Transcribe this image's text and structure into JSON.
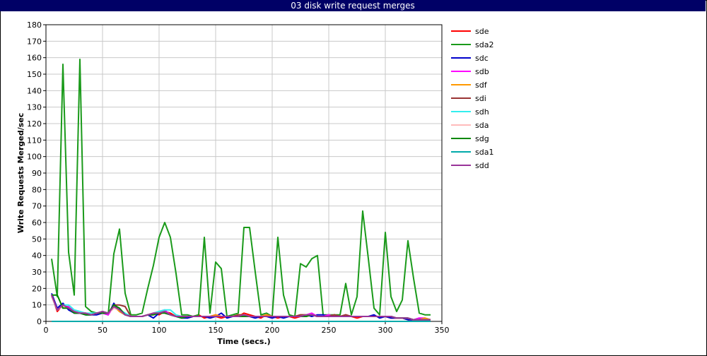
{
  "chart_data": {
    "type": "line",
    "title": "03 disk write request merges",
    "xlabel": "Time (secs.)",
    "ylabel": "Write Requests Merged/sec",
    "xlim": [
      0,
      350
    ],
    "ylim": [
      0,
      180
    ],
    "xticks": [
      0,
      50,
      100,
      150,
      200,
      250,
      300,
      350
    ],
    "yticks": [
      0,
      10,
      20,
      30,
      40,
      50,
      60,
      70,
      80,
      90,
      100,
      110,
      120,
      130,
      140,
      150,
      160,
      170,
      180
    ],
    "grid": true,
    "legend_position": "right",
    "x": [
      5,
      10,
      15,
      20,
      25,
      30,
      35,
      40,
      45,
      50,
      55,
      60,
      65,
      70,
      75,
      80,
      85,
      90,
      95,
      100,
      105,
      110,
      115,
      120,
      125,
      130,
      135,
      140,
      145,
      150,
      155,
      160,
      165,
      170,
      175,
      180,
      185,
      190,
      195,
      200,
      205,
      210,
      215,
      220,
      225,
      230,
      235,
      240,
      245,
      250,
      255,
      260,
      265,
      270,
      275,
      280,
      285,
      290,
      295,
      300,
      305,
      310,
      315,
      320,
      325,
      330,
      335,
      340
    ],
    "series": [
      {
        "name": "sde",
        "color": "#ff0000",
        "values": [
          16,
          6,
          10,
          8,
          5,
          5,
          5,
          4,
          5,
          6,
          5,
          8,
          7,
          4,
          3,
          3,
          3,
          4,
          5,
          4,
          6,
          5,
          3,
          3,
          2,
          3,
          4,
          2,
          3,
          3,
          2,
          3,
          3,
          3,
          5,
          4,
          3,
          2,
          4,
          3,
          2,
          3,
          3,
          2,
          3,
          3,
          4,
          3,
          3,
          3,
          4,
          3,
          3,
          3,
          2,
          3,
          3,
          3,
          3,
          3,
          2,
          2,
          2,
          1,
          1,
          1,
          2,
          1
        ]
      },
      {
        "name": "sda2",
        "color": "#1a9a1a",
        "values": [
          38,
          15,
          156,
          42,
          16,
          159,
          9,
          6,
          5,
          5,
          4,
          41,
          56,
          17,
          4,
          4,
          5,
          20,
          34,
          51,
          60,
          51,
          29,
          4,
          4,
          3,
          4,
          51,
          5,
          36,
          32,
          3,
          4,
          5,
          57,
          57,
          30,
          4,
          5,
          3,
          51,
          16,
          4,
          3,
          35,
          33,
          38,
          40,
          4,
          4,
          4,
          4,
          23,
          4,
          15,
          67,
          38,
          8,
          4,
          54,
          15,
          6,
          13,
          49,
          26,
          5,
          4,
          4
        ]
      },
      {
        "name": "sdc",
        "color": "#0000cc",
        "values": [
          17,
          8,
          11,
          7,
          5,
          5,
          4,
          4,
          4,
          5,
          4,
          11,
          6,
          4,
          3,
          3,
          3,
          4,
          2,
          5,
          6,
          4,
          3,
          2,
          2,
          3,
          3,
          3,
          2,
          3,
          5,
          2,
          3,
          3,
          3,
          3,
          2,
          3,
          3,
          2,
          3,
          2,
          3,
          3,
          3,
          4,
          3,
          4,
          4,
          3,
          4,
          3,
          4,
          3,
          3,
          3,
          3,
          4,
          2,
          3,
          2,
          2,
          2,
          1,
          1,
          2,
          1,
          1
        ]
      },
      {
        "name": "sdb",
        "color": "#ff00ff",
        "values": [
          16,
          7,
          9,
          9,
          6,
          5,
          5,
          4,
          5,
          5,
          4,
          9,
          7,
          4,
          3,
          3,
          3,
          4,
          4,
          6,
          7,
          4,
          3,
          3,
          3,
          3,
          3,
          3,
          3,
          4,
          3,
          3,
          3,
          3,
          4,
          3,
          3,
          3,
          4,
          3,
          3,
          3,
          3,
          3,
          4,
          4,
          5,
          3,
          3,
          4,
          3,
          3,
          4,
          3,
          3,
          3,
          3,
          3,
          3,
          3,
          3,
          2,
          2,
          2,
          1,
          2,
          2,
          1
        ]
      },
      {
        "name": "sdf",
        "color": "#ff9900",
        "values": [
          15,
          7,
          10,
          8,
          6,
          5,
          5,
          4,
          5,
          6,
          5,
          9,
          6,
          4,
          3,
          3,
          3,
          4,
          5,
          5,
          6,
          4,
          3,
          3,
          3,
          3,
          3,
          3,
          3,
          4,
          3,
          3,
          3,
          4,
          4,
          3,
          3,
          3,
          4,
          3,
          3,
          3,
          3,
          3,
          4,
          4,
          4,
          3,
          3,
          3,
          4,
          3,
          4,
          3,
          3,
          3,
          3,
          3,
          3,
          3,
          3,
          2,
          2,
          2,
          1,
          1,
          2,
          1
        ]
      },
      {
        "name": "sdi",
        "color": "#993333",
        "values": [
          16,
          7,
          10,
          8,
          6,
          5,
          5,
          4,
          5,
          6,
          5,
          10,
          10,
          9,
          3,
          3,
          3,
          4,
          5,
          6,
          6,
          4,
          3,
          3,
          3,
          3,
          3,
          3,
          3,
          3,
          3,
          3,
          3,
          4,
          4,
          3,
          3,
          3,
          3,
          3,
          3,
          3,
          3,
          3,
          4,
          4,
          4,
          3,
          3,
          3,
          4,
          3,
          4,
          3,
          3,
          3,
          3,
          3,
          3,
          3,
          3,
          2,
          2,
          2,
          1,
          1,
          1,
          1
        ]
      },
      {
        "name": "sdh",
        "color": "#33eeee",
        "values": [
          15,
          7,
          10,
          10,
          7,
          6,
          5,
          5,
          5,
          6,
          5,
          9,
          7,
          5,
          3,
          3,
          3,
          4,
          5,
          6,
          7,
          7,
          4,
          3,
          3,
          3,
          3,
          3,
          3,
          3,
          3,
          3,
          3,
          3,
          4,
          3,
          3,
          3,
          3,
          3,
          3,
          3,
          3,
          3,
          3,
          4,
          4,
          3,
          3,
          3,
          3,
          3,
          3,
          3,
          3,
          3,
          3,
          3,
          3,
          3,
          3,
          2,
          2,
          2,
          1,
          1,
          1,
          1
        ]
      },
      {
        "name": "sda",
        "color": "#ffbbbb",
        "values": [
          15,
          7,
          9,
          8,
          6,
          5,
          5,
          4,
          5,
          6,
          5,
          8,
          7,
          4,
          3,
          3,
          3,
          4,
          5,
          5,
          6,
          4,
          3,
          3,
          3,
          3,
          3,
          3,
          3,
          3,
          3,
          3,
          3,
          3,
          4,
          3,
          3,
          3,
          3,
          3,
          3,
          3,
          3,
          3,
          3,
          4,
          4,
          3,
          3,
          3,
          3,
          3,
          3,
          3,
          3,
          3,
          3,
          3,
          3,
          3,
          3,
          2,
          2,
          2,
          1,
          1,
          1,
          1
        ]
      },
      {
        "name": "sdg",
        "color": "#008800",
        "values": [
          16,
          16,
          8,
          8,
          5,
          5,
          4,
          4,
          5,
          5,
          5,
          10,
          8,
          4,
          3,
          3,
          3,
          4,
          4,
          5,
          5,
          4,
          3,
          2,
          3,
          3,
          3,
          3,
          3,
          3,
          3,
          3,
          3,
          3,
          3,
          3,
          3,
          3,
          3,
          3,
          3,
          3,
          3,
          3,
          3,
          3,
          4,
          3,
          3,
          3,
          3,
          3,
          3,
          3,
          3,
          3,
          3,
          3,
          3,
          3,
          3,
          2,
          2,
          2,
          1,
          1,
          1,
          1
        ]
      },
      {
        "name": "sda1",
        "color": "#00aaaa",
        "values": [
          0,
          0,
          0,
          0,
          0,
          0,
          0,
          0,
          0,
          0,
          0,
          0,
          0,
          0,
          0,
          0,
          0,
          0,
          0,
          0,
          0,
          0,
          0,
          0,
          0,
          0,
          0,
          0,
          0,
          0,
          0,
          0,
          0,
          0,
          0,
          0,
          0,
          0,
          0,
          0,
          0,
          0,
          0,
          0,
          0,
          0,
          0,
          0,
          0,
          0,
          0,
          0,
          0,
          0,
          0,
          0,
          0,
          0,
          0,
          0,
          0,
          0,
          0,
          0,
          0,
          0,
          0,
          0
        ]
      },
      {
        "name": "sdd",
        "color": "#993399",
        "values": [
          16,
          7,
          10,
          8,
          6,
          5,
          5,
          4,
          5,
          6,
          5,
          9,
          7,
          4,
          3,
          3,
          3,
          4,
          5,
          5,
          6,
          4,
          3,
          3,
          3,
          3,
          3,
          3,
          3,
          3,
          3,
          3,
          3,
          3,
          4,
          3,
          3,
          3,
          3,
          3,
          3,
          3,
          3,
          3,
          3,
          4,
          4,
          3,
          3,
          3,
          3,
          3,
          3,
          3,
          3,
          3,
          3,
          3,
          3,
          3,
          3,
          2,
          2,
          2,
          1,
          1,
          1,
          1
        ]
      }
    ]
  }
}
